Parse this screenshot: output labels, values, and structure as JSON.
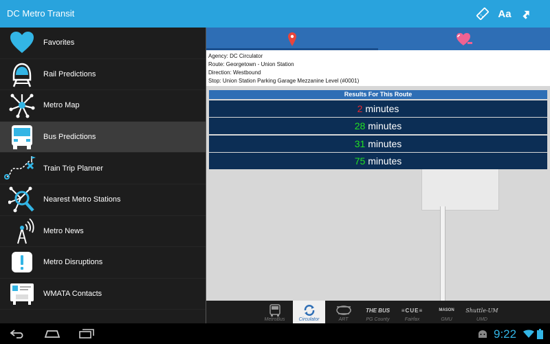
{
  "app": {
    "title": "DC Metro Transit"
  },
  "actionbar": {
    "icons": [
      "ticket-icon",
      "font-size-icon",
      "share-icon"
    ],
    "font_icon_text": "Aa"
  },
  "drawer": {
    "items": [
      {
        "label": "Favorites",
        "icon": "heart-icon"
      },
      {
        "label": "Rail Predictions",
        "icon": "train-icon"
      },
      {
        "label": "Metro Map",
        "icon": "metro-map-icon"
      },
      {
        "label": "Bus Predictions",
        "icon": "bus-icon",
        "active": true
      },
      {
        "label": "Train Trip Planner",
        "icon": "trip-planner-icon"
      },
      {
        "label": "Nearest Metro Stations",
        "icon": "nearest-stations-icon"
      },
      {
        "label": "Metro News",
        "icon": "antenna-icon"
      },
      {
        "label": "Metro Disruptions",
        "icon": "alert-icon"
      },
      {
        "label": "WMATA Contacts",
        "icon": "contacts-icon"
      }
    ]
  },
  "tabs": [
    {
      "name": "map-pin-icon",
      "active": true
    },
    {
      "name": "heart-icon"
    }
  ],
  "info": {
    "agency": "Agency: DC Circulator",
    "route": "Route: Georgetown - Union Station",
    "direction": "Direction: Westbound",
    "stop": "Stop: Union Station Parking Garage Mezzanine Level (#0001)"
  },
  "results": {
    "header": "Results For This Route",
    "unit": "minutes",
    "rows": [
      {
        "value": "2",
        "color": "#e8262e"
      },
      {
        "value": "28",
        "color": "#22e022"
      },
      {
        "value": "31",
        "color": "#22e022"
      },
      {
        "value": "75",
        "color": "#22e022"
      }
    ]
  },
  "agencies": [
    {
      "label": "MetroBus",
      "logo": ""
    },
    {
      "label": "Circulator",
      "logo": "",
      "active": true
    },
    {
      "label": "ART",
      "logo": ""
    },
    {
      "label": "PG County",
      "logo": "THE BUS"
    },
    {
      "label": "Fairfax",
      "logo": "CUE"
    },
    {
      "label": "GMU",
      "logo": "MASON"
    },
    {
      "label": "UMD",
      "logo": "Shuttle-UM"
    }
  ],
  "system": {
    "clock": "9:22",
    "colors": {
      "accent": "#29a3dd",
      "clock": "#33b5e5"
    }
  }
}
